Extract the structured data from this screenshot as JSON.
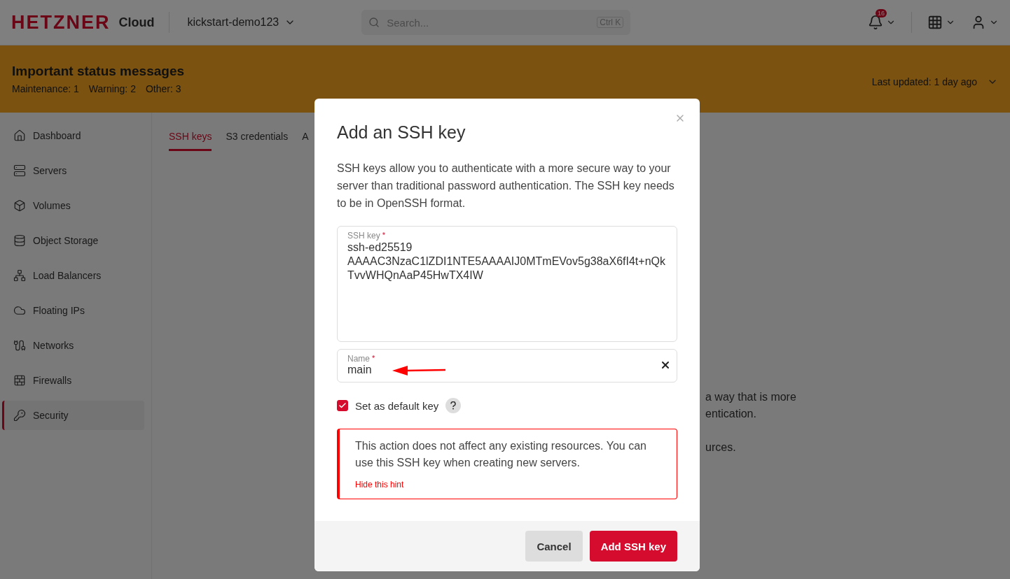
{
  "header": {
    "logo": "HETZNER",
    "product": "Cloud",
    "project": "kickstart-demo123",
    "search": {
      "placeholder": "Search...",
      "shortcut": "Ctrl K"
    },
    "notification_count": "16"
  },
  "status_banner": {
    "title": "Important status messages",
    "counts": [
      {
        "label": "Maintenance:",
        "value": "1"
      },
      {
        "label": "Warning:",
        "value": "2"
      },
      {
        "label": "Other:",
        "value": "3"
      }
    ],
    "last_updated_label": "Last updated:",
    "last_updated_value": "1 day ago"
  },
  "sidebar": {
    "items": [
      {
        "label": "Dashboard",
        "selected": false
      },
      {
        "label": "Servers",
        "selected": false
      },
      {
        "label": "Volumes",
        "selected": false
      },
      {
        "label": "Object Storage",
        "selected": false
      },
      {
        "label": "Load Balancers",
        "selected": false
      },
      {
        "label": "Floating IPs",
        "selected": false
      },
      {
        "label": "Networks",
        "selected": false
      },
      {
        "label": "Firewalls",
        "selected": false
      },
      {
        "label": "Security",
        "selected": true
      }
    ]
  },
  "tabs": [
    {
      "label": "SSH keys",
      "selected": true
    },
    {
      "label": "S3 credentials",
      "selected": false
    },
    {
      "label": "A",
      "selected": false
    }
  ],
  "background_text": [
    "a way that is more",
    "entication.",
    "urces."
  ],
  "dialog": {
    "title": "Add an SSH key",
    "description": "SSH keys allow you to authenticate with a more secure way to your server than traditional password authentication. The SSH key needs to be in OpenSSH format.",
    "ssh_key_field": {
      "label": "SSH key",
      "required_mark": "*",
      "value": "ssh-ed25519 AAAAC3NzaC1lZDI1NTE5AAAAIJ0MTmEVov5g38aX6fI4t+nQkTvvWHQnAaP45HwTX4IW"
    },
    "name_field": {
      "label": "Name",
      "required_mark": "*",
      "value": "main"
    },
    "default_checkbox": {
      "label": "Set as default key",
      "checked": true
    },
    "hint": {
      "text": "This action does not affect any existing resources. You can use this SSH key when creating new servers.",
      "link": "Hide this hint"
    },
    "buttons": {
      "cancel": "Cancel",
      "submit": "Add SSH key"
    }
  }
}
